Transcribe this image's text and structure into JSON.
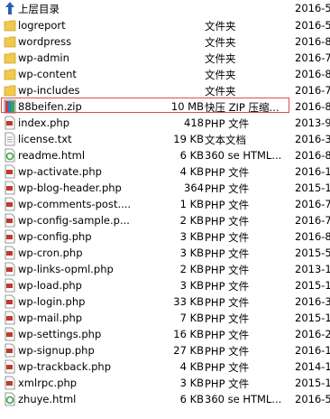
{
  "up": {
    "label": "上层目录",
    "date": "2016-5"
  },
  "files": [
    {
      "icon": "folder-icon",
      "name": "logreport",
      "size": "",
      "type": "文件夹",
      "date": "2016-5"
    },
    {
      "icon": "folder-icon",
      "name": "wordpress",
      "size": "",
      "type": "文件夹",
      "date": "2016-8"
    },
    {
      "icon": "folder-icon",
      "name": "wp-admin",
      "size": "",
      "type": "文件夹",
      "date": "2016-7"
    },
    {
      "icon": "folder-icon",
      "name": "wp-content",
      "size": "",
      "type": "文件夹",
      "date": "2016-8"
    },
    {
      "icon": "folder-icon",
      "name": "wp-includes",
      "size": "",
      "type": "文件夹",
      "date": "2016-7"
    },
    {
      "icon": "zip-icon",
      "name": "88beifen.zip",
      "size": "10 MB",
      "type": "快压 ZIP 压缩...",
      "date": "2016-8"
    },
    {
      "icon": "php-icon",
      "name": "index.php",
      "size": "418",
      "type": "PHP 文件",
      "date": "2013-9"
    },
    {
      "icon": "text-file-icon",
      "name": "license.txt",
      "size": "19 KB",
      "type": "文本文档",
      "date": "2016-3"
    },
    {
      "icon": "html-icon",
      "name": "readme.html",
      "size": "6 KB",
      "type": "360 se HTML...",
      "date": "2016-8"
    },
    {
      "icon": "php-icon",
      "name": "wp-activate.php",
      "size": "4 KB",
      "type": "PHP 文件",
      "date": "2016-1"
    },
    {
      "icon": "php-icon",
      "name": "wp-blog-header.php",
      "size": "364",
      "type": "PHP 文件",
      "date": "2015-1"
    },
    {
      "icon": "php-icon",
      "name": "wp-comments-post....",
      "size": "1 KB",
      "type": "PHP 文件",
      "date": "2016-7"
    },
    {
      "icon": "php-icon",
      "name": "wp-config-sample.p...",
      "size": "2 KB",
      "type": "PHP 文件",
      "date": "2016-7"
    },
    {
      "icon": "php-icon",
      "name": "wp-config.php",
      "size": "3 KB",
      "type": "PHP 文件",
      "date": "2016-8"
    },
    {
      "icon": "php-icon",
      "name": "wp-cron.php",
      "size": "3 KB",
      "type": "PHP 文件",
      "date": "2015-5"
    },
    {
      "icon": "php-icon",
      "name": "wp-links-opml.php",
      "size": "2 KB",
      "type": "PHP 文件",
      "date": "2013-1"
    },
    {
      "icon": "php-icon",
      "name": "wp-load.php",
      "size": "3 KB",
      "type": "PHP 文件",
      "date": "2015-1"
    },
    {
      "icon": "php-icon",
      "name": "wp-login.php",
      "size": "33 KB",
      "type": "PHP 文件",
      "date": "2016-3"
    },
    {
      "icon": "php-icon",
      "name": "wp-mail.php",
      "size": "7 KB",
      "type": "PHP 文件",
      "date": "2015-1"
    },
    {
      "icon": "php-icon",
      "name": "wp-settings.php",
      "size": "16 KB",
      "type": "PHP 文件",
      "date": "2016-2"
    },
    {
      "icon": "php-icon",
      "name": "wp-signup.php",
      "size": "27 KB",
      "type": "PHP 文件",
      "date": "2016-1"
    },
    {
      "icon": "php-icon",
      "name": "wp-trackback.php",
      "size": "4 KB",
      "type": "PHP 文件",
      "date": "2014-1"
    },
    {
      "icon": "php-icon",
      "name": "xmlrpc.php",
      "size": "3 KB",
      "type": "PHP 文件",
      "date": "2015-1"
    },
    {
      "icon": "html-icon",
      "name": "zhuye.html",
      "size": "6 KB",
      "type": "360 se HTML...",
      "date": "2016-5"
    }
  ],
  "colors": {
    "folder": "#f2c94c",
    "highlight_border": "#e34b4b",
    "up_arrow": "#2a5fb8"
  }
}
